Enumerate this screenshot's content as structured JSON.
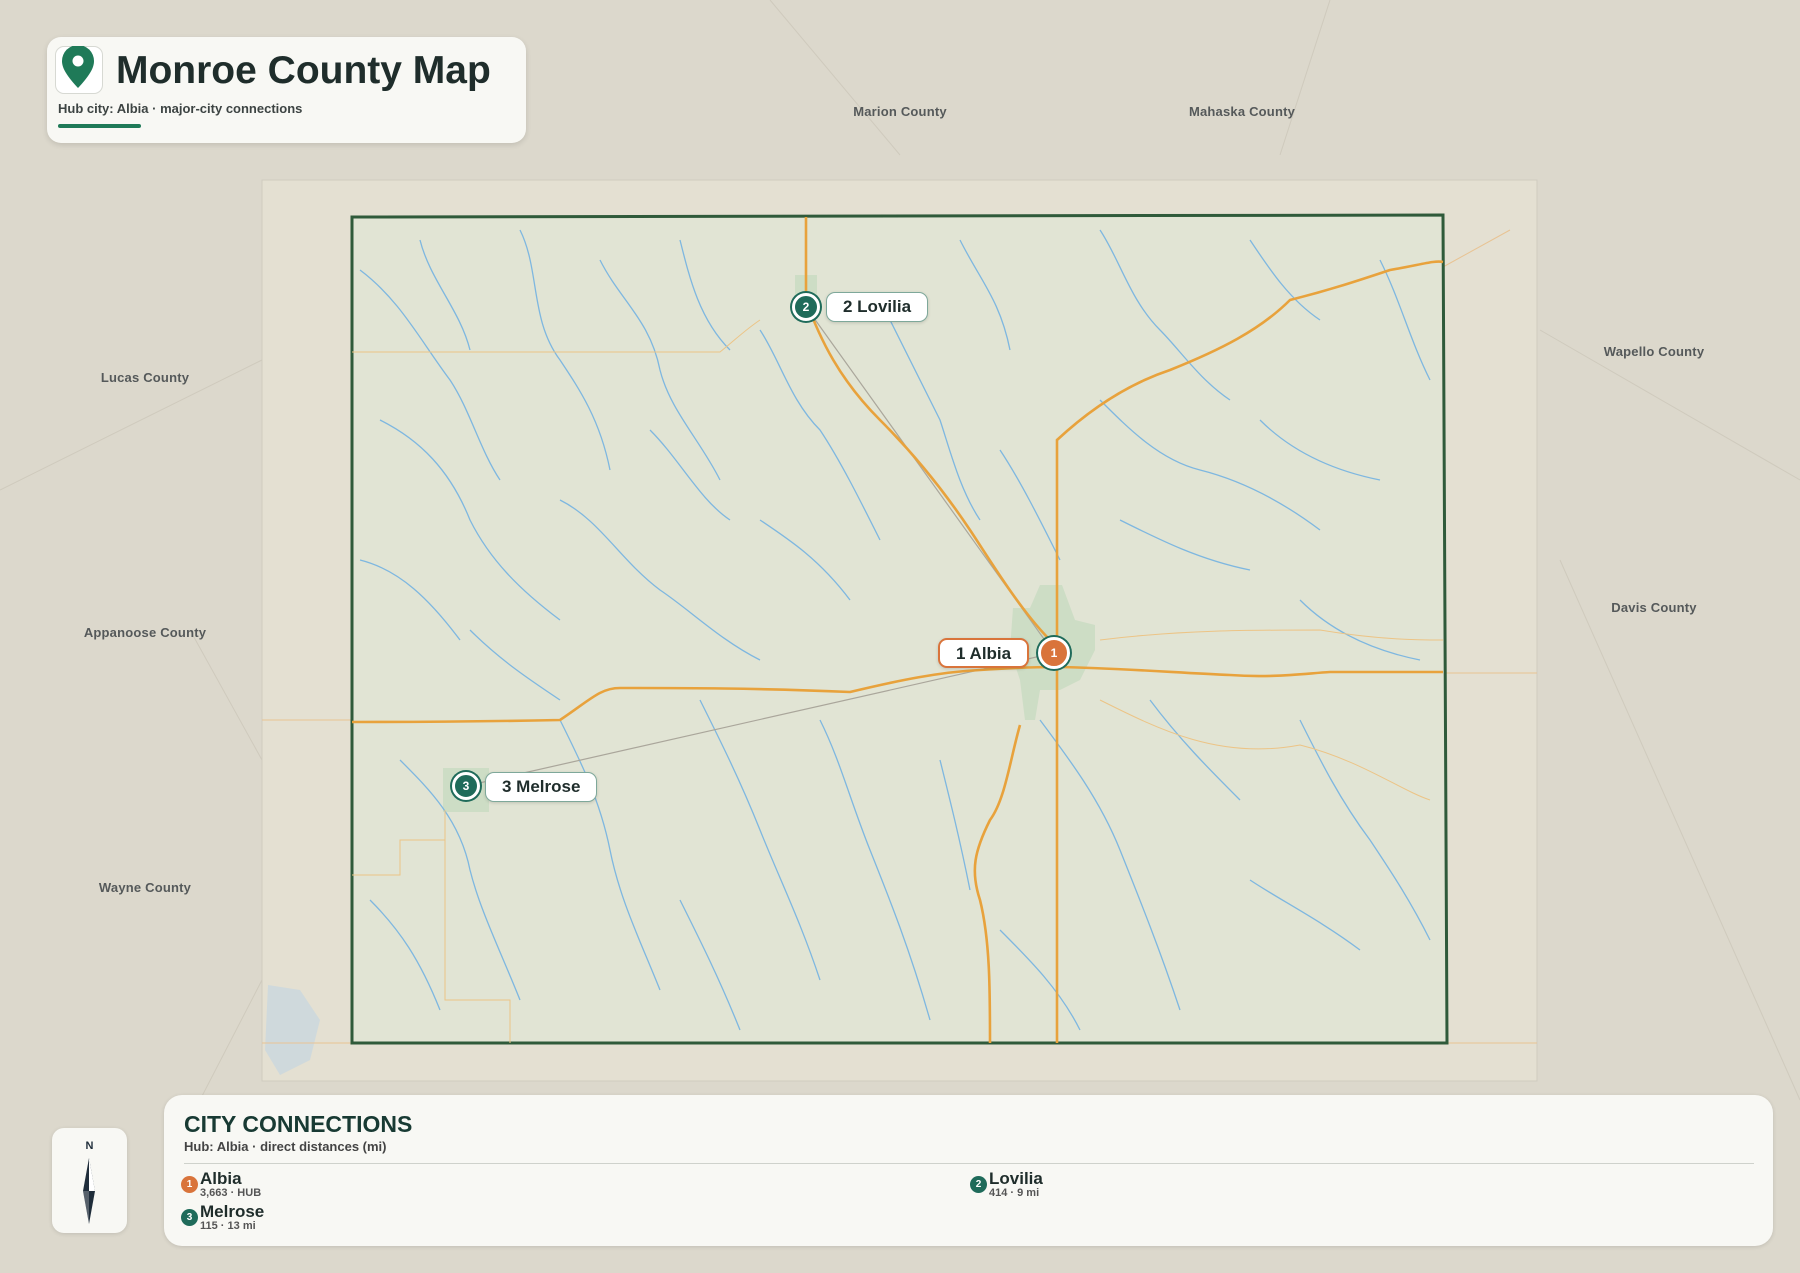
{
  "header": {
    "title": "Monroe County Map",
    "subtitle": "Hub city: Albia · major-city connections",
    "icon": "map-pin-icon"
  },
  "neighbors": [
    {
      "name": "Marion County"
    },
    {
      "name": "Mahaska County"
    },
    {
      "name": "Lucas County"
    },
    {
      "name": "Wapello County"
    },
    {
      "name": "Appanoose County"
    },
    {
      "name": "Davis County"
    },
    {
      "name": "Wayne County"
    }
  ],
  "cities": [
    {
      "rank": "1",
      "name": "Albia",
      "label": "1 Albia",
      "population": "3,663",
      "detail": "3,663 · HUB",
      "hub": true
    },
    {
      "rank": "2",
      "name": "Lovilia",
      "label": "2 Lovilia",
      "population": "414",
      "distance_mi": 9,
      "detail": "414 · 9 mi",
      "hub": false
    },
    {
      "rank": "3",
      "name": "Melrose",
      "label": "3 Melrose",
      "population": "115",
      "distance_mi": 13,
      "detail": "115 · 13 mi",
      "hub": false
    }
  ],
  "compass": {
    "label": "N",
    "icon": "compass-arrow-icon"
  },
  "panel": {
    "title": "CITY CONNECTIONS",
    "subtitle": "Hub: Albia · direct distances (mi)"
  },
  "colors": {
    "county_border": "#2f5a3a",
    "county_fill": "#e1e4d4",
    "roads": "#e8a23c",
    "rivers": "#7eb7e0",
    "hub_marker": "#d9743b",
    "city_marker": "#1f6b5a",
    "accent": "#1f7a58"
  }
}
